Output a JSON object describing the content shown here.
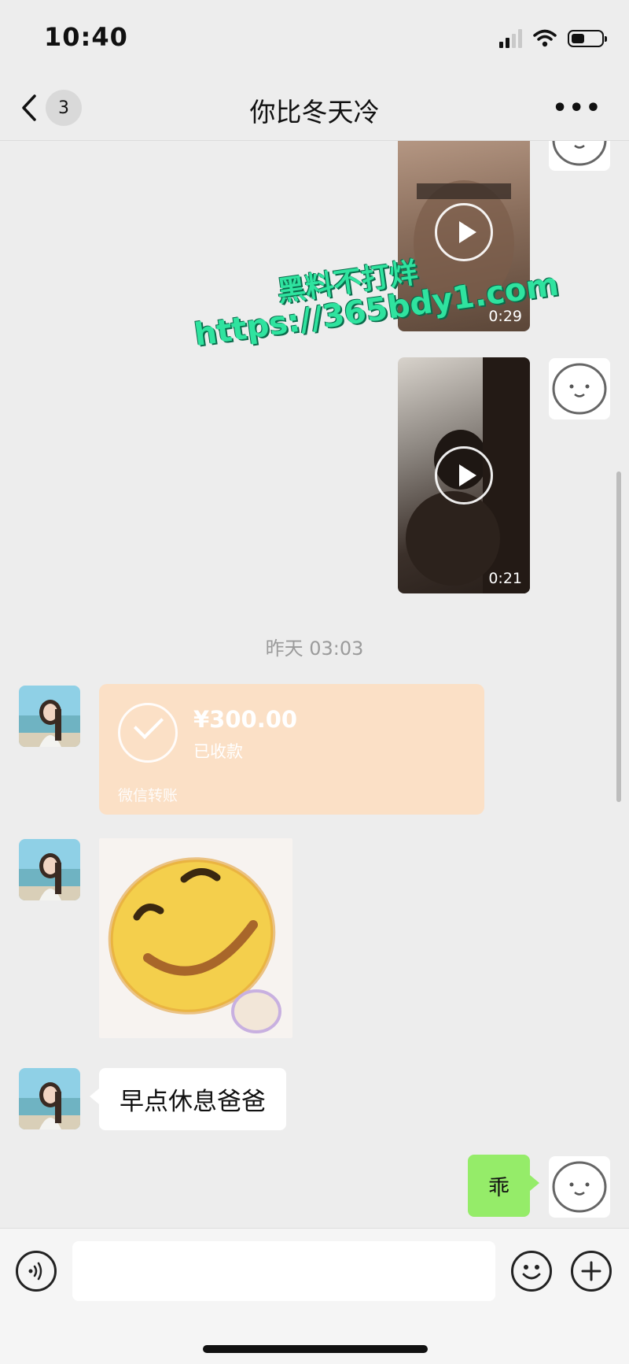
{
  "status_bar": {
    "time": "10:40"
  },
  "nav": {
    "back_count": "3",
    "title": "你比冬天冷",
    "more": "•••"
  },
  "messages": {
    "video1_duration": "0:29",
    "video2_duration": "0:21",
    "timestamp": "昨天 03:03",
    "transfer_amount": "¥300.00",
    "transfer_status": "已收款",
    "transfer_footer": "微信转账",
    "text_left": "早点休息爸爸",
    "text_right": "乖"
  },
  "watermark": {
    "line1": "黑料不打烊",
    "line2": "https://365bdy1.com"
  },
  "input": {
    "value": ""
  },
  "colors": {
    "bg": "#ededed",
    "my_bubble": "#95ec69",
    "transfer": "#fbe0c6",
    "watermark": "#2fe39f"
  }
}
